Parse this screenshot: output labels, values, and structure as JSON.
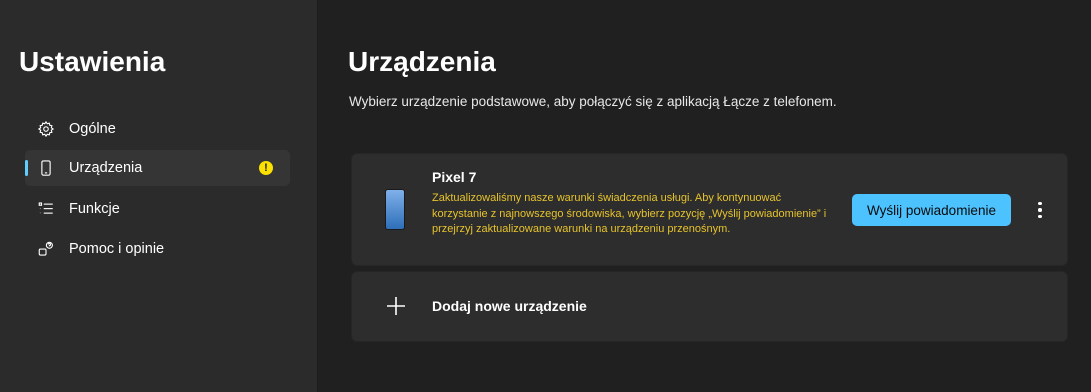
{
  "sidebar": {
    "title": "Ustawienia",
    "items": [
      {
        "label": "Ogólne",
        "icon": "gear-icon"
      },
      {
        "label": "Urządzenia",
        "icon": "phone-icon",
        "active": true,
        "badge": "!"
      },
      {
        "label": "Funkcje",
        "icon": "list-icon"
      },
      {
        "label": "Pomoc i opinie",
        "icon": "help-icon"
      }
    ]
  },
  "main": {
    "title": "Urządzenia",
    "subtitle": "Wybierz urządzenie podstawowe, aby połączyć się z aplikacją Łącze z telefonem.",
    "device": {
      "name": "Pixel 7",
      "warning": "Zaktualizowaliśmy nasze warunki świadczenia usługi. Aby kontynuować korzystanie z najnowszego środowiska, wybierz pozycję „Wyślij powiadomienie” i przejrzyj zaktualizowane warunki na urządzeniu przenośnym.",
      "button_label": "Wyślij powiadomienie"
    },
    "add_device_label": "Dodaj nowe urządzenie"
  },
  "colors": {
    "accent": "#60cdff",
    "button": "#4cc2ff",
    "warning_text": "#e6c32c",
    "badge": "#fce100"
  }
}
